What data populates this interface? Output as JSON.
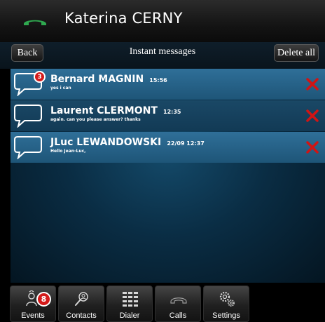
{
  "header": {
    "contact_name": "Katerina CERNY",
    "call_icon": "handset-icon",
    "call_icon_color": "#2fa84f"
  },
  "toolbar": {
    "back_label": "Back",
    "title": "Instant messages",
    "delete_all_label": "Delete all"
  },
  "messages": [
    {
      "sender": "Bernard MAGNIN",
      "time": "15:56",
      "preview": "yes i can",
      "unread_count": "3"
    },
    {
      "sender": "Laurent CLERMONT",
      "time": "12:35",
      "preview": "again. can you please answer? thanks"
    },
    {
      "sender": "JLuc LEWANDOWSKI",
      "time": "22/09 12:37",
      "preview": "Hello Jean-Luc,"
    }
  ],
  "tabs": [
    {
      "label": "Events",
      "icon": "person-bell-icon",
      "badge": "8"
    },
    {
      "label": "Contacts",
      "icon": "search-contact-icon"
    },
    {
      "label": "Dialer",
      "icon": "keypad-icon"
    },
    {
      "label": "Calls",
      "icon": "handset-icon"
    },
    {
      "label": "Settings",
      "icon": "gears-icon"
    }
  ],
  "colors": {
    "unread_badge": "#d41a1a",
    "delete_x": "#d11414",
    "row_highlight": "#2f6f98"
  }
}
